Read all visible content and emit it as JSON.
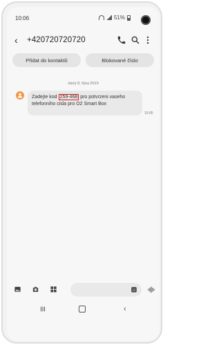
{
  "status": {
    "time": "10:06",
    "battery": "51%"
  },
  "header": {
    "title": "+420720720720"
  },
  "chips": {
    "add_contact": "Přidat do kontaktů",
    "blocked_numbers": "Blokované číslo"
  },
  "conversation": {
    "date": "úterý 8. října 2019",
    "message": {
      "prefix": "Zadejte kod",
      "code": "259-468",
      "suffix": "pro potvrzeni vaseho telefonniho cisla pro O2 Smart Box",
      "time": "10:05"
    }
  },
  "composer": {
    "placeholder": ""
  },
  "colors": {
    "avatar": "#f2994a",
    "highlight": "#e11c1c",
    "bubble": "#e9e9e9"
  }
}
